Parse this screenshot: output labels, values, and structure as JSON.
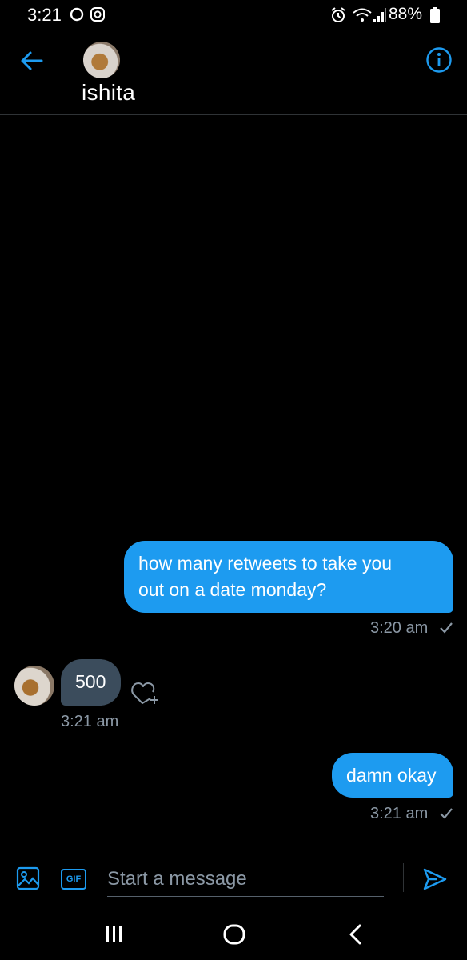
{
  "status_bar": {
    "time": "3:21",
    "battery": "88%"
  },
  "header": {
    "contact_name": "ishita"
  },
  "messages": [
    {
      "direction": "outgoing",
      "text": "how many retweets to take you out on a date monday?",
      "line1": "how many retweets to take you",
      "line2": "out on a date monday?",
      "time": "3:20 am",
      "read": true
    },
    {
      "direction": "incoming",
      "text": "500",
      "time": "3:21 am"
    },
    {
      "direction": "outgoing",
      "text": "damn okay",
      "time": "3:21 am",
      "read": true
    }
  ],
  "composer": {
    "gif_label": "GIF",
    "placeholder": "Start a message"
  },
  "colors": {
    "accent": "#1d9bf0",
    "background": "#000000",
    "incoming_bubble": "#3b4c5c",
    "meta_text": "#8b98a5"
  },
  "icons": {
    "status": [
      "sync-icon",
      "instagram-icon",
      "alarm-icon",
      "wifi-icon",
      "signal-icon",
      "battery-icon"
    ],
    "header": [
      "back-arrow-icon",
      "info-icon"
    ],
    "composer": [
      "image-icon",
      "gif-icon",
      "send-icon"
    ],
    "nav": [
      "recent-apps-icon",
      "home-icon",
      "back-icon"
    ]
  }
}
